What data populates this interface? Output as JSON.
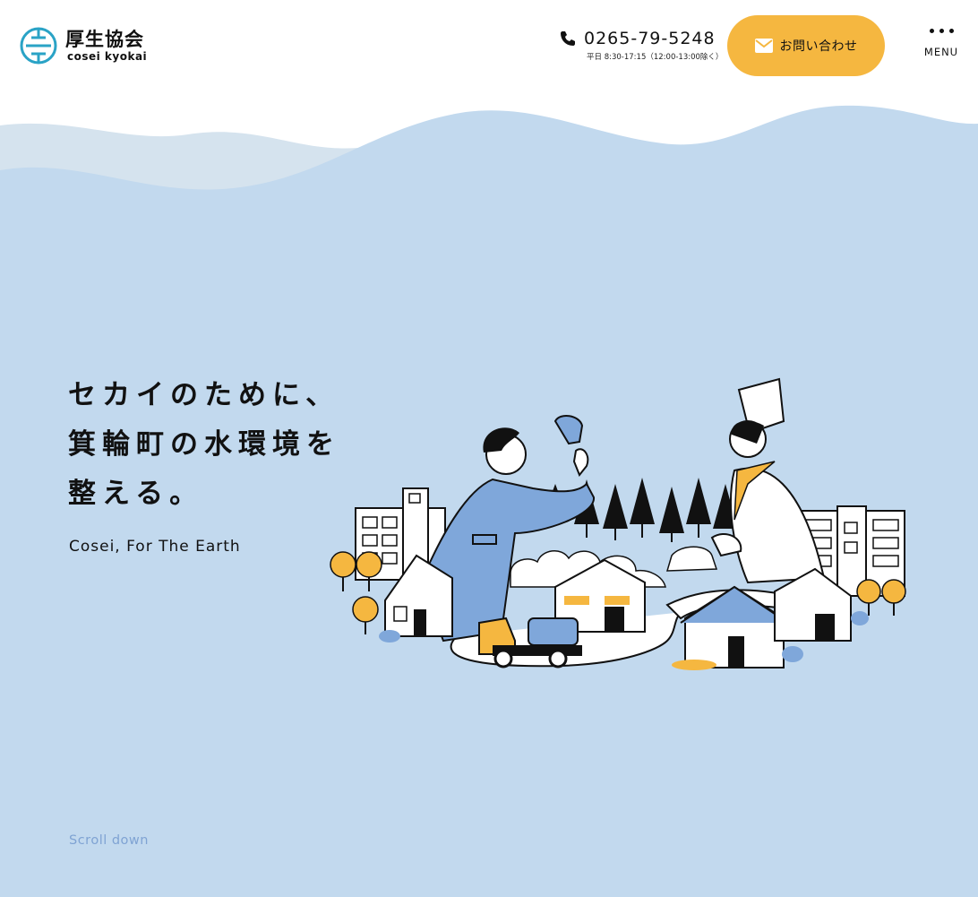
{
  "header": {
    "logo": {
      "name_jp": "厚生協会",
      "name_en": "cosei kyokai",
      "mark_color": "#2aa3c6"
    },
    "phone": {
      "number": "0265-79-5248",
      "hours": "平日 8:30-17:15（12:00-13:00除く）"
    },
    "contact_button": {
      "label": "お問い合わせ",
      "color": "#f5b740"
    },
    "menu": {
      "label": "MENU"
    }
  },
  "hero": {
    "headline_lines": [
      "セカイのために、",
      "箕輪町の水環境を",
      "整える。"
    ],
    "tagline": "Cosei, For The Earth",
    "background_color": "#c2d9ee"
  },
  "scroll": {
    "label": "Scroll down",
    "color": "#7fa3d3"
  }
}
